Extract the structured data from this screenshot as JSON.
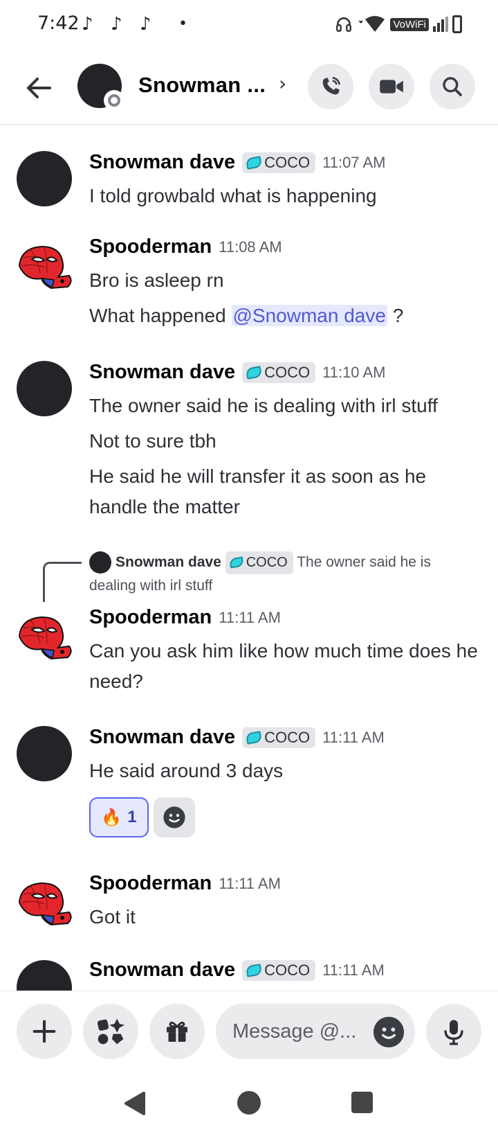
{
  "status_bar": {
    "time": "7:42",
    "notification_icons": [
      "tiktok-icon",
      "tiktok-icon",
      "tiktok-icon"
    ],
    "dot": "•",
    "network_label": "VoWiFi"
  },
  "header": {
    "title": "Snowman ...",
    "chevron": "›"
  },
  "messages": [
    {
      "author": "Snowman dave",
      "tag": "COCO",
      "time": "11:07 AM",
      "lines": [
        "I told growbald what is happening"
      ]
    },
    {
      "author": "Spooderman",
      "time": "11:08 AM",
      "lines": [
        "Bro is asleep rn",
        "What happened"
      ],
      "mention": "@Snowman dave",
      "after_mention": " ?"
    },
    {
      "author": "Snowman dave",
      "tag": "COCO",
      "time": "11:10 AM",
      "lines": [
        "The owner said he is dealing with irl stuff",
        "Not to sure tbh",
        "He said he will transfer it as soon as he handle the matter"
      ]
    },
    {
      "author": "Spooderman",
      "time": "11:11 AM",
      "reply_to": {
        "author": "Snowman dave",
        "tag": "COCO",
        "text": "The owner said he is dealing with irl stuff"
      },
      "lines": [
        "Can you ask him like how much time does he need?"
      ]
    },
    {
      "author": "Snowman dave",
      "tag": "COCO",
      "time": "11:11 AM",
      "lines": [
        "He said around 3 days"
      ],
      "reaction": {
        "emoji": "🔥",
        "count": "1"
      }
    },
    {
      "author": "Spooderman",
      "time": "11:11 AM",
      "lines": [
        "Got it"
      ]
    },
    {
      "author": "Snowman dave",
      "tag": "COCO",
      "time": "11:11 AM",
      "lines": []
    }
  ],
  "input": {
    "placeholder": "Message @..."
  },
  "colors": {
    "accent": "#5865f2",
    "mention_bg": "#e6e8fd",
    "mention_text": "#4e5ad0",
    "tag_leaf": "#2fd4e0"
  }
}
